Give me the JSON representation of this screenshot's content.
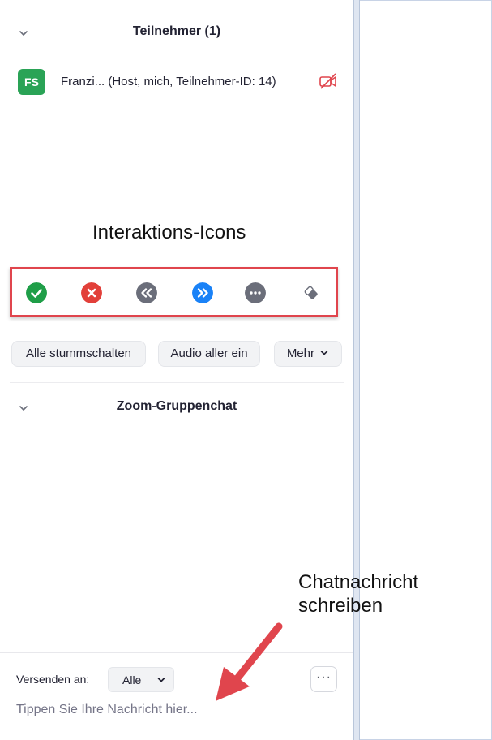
{
  "participants_panel": {
    "header": "Teilnehmer (1)",
    "participant": {
      "initials": "FS",
      "name_text": "Franzi...  (Host, mich, Teilnehmer-ID: 14)",
      "avatar_color": "#2aa356"
    }
  },
  "annotations": {
    "icons_title": "Interaktions-Icons",
    "chat_title_line1": "Chatnachricht",
    "chat_title_line2": "schreiben",
    "highlight_color": "#e0454d"
  },
  "reaction_icons": [
    {
      "name": "yes-icon",
      "color": "#1f9e48"
    },
    {
      "name": "no-icon",
      "color": "#e2403a"
    },
    {
      "name": "go-slower-icon",
      "color": "#6b6e7a"
    },
    {
      "name": "go-faster-icon",
      "color": "#1a82f7"
    },
    {
      "name": "more-icon",
      "color": "#6b6e7a"
    },
    {
      "name": "clear-icon",
      "color": "#6b6e7a"
    }
  ],
  "buttons": {
    "mute_all": "Alle stummschalten",
    "unmute_all": "Audio aller ein",
    "more": "Mehr"
  },
  "chat": {
    "header": "Zoom-Gruppenchat",
    "send_to_label": "Versenden an:",
    "send_to_value": "Alle",
    "more_options": "···",
    "input_placeholder": "Tippen Sie Ihre Nachricht hier..."
  }
}
